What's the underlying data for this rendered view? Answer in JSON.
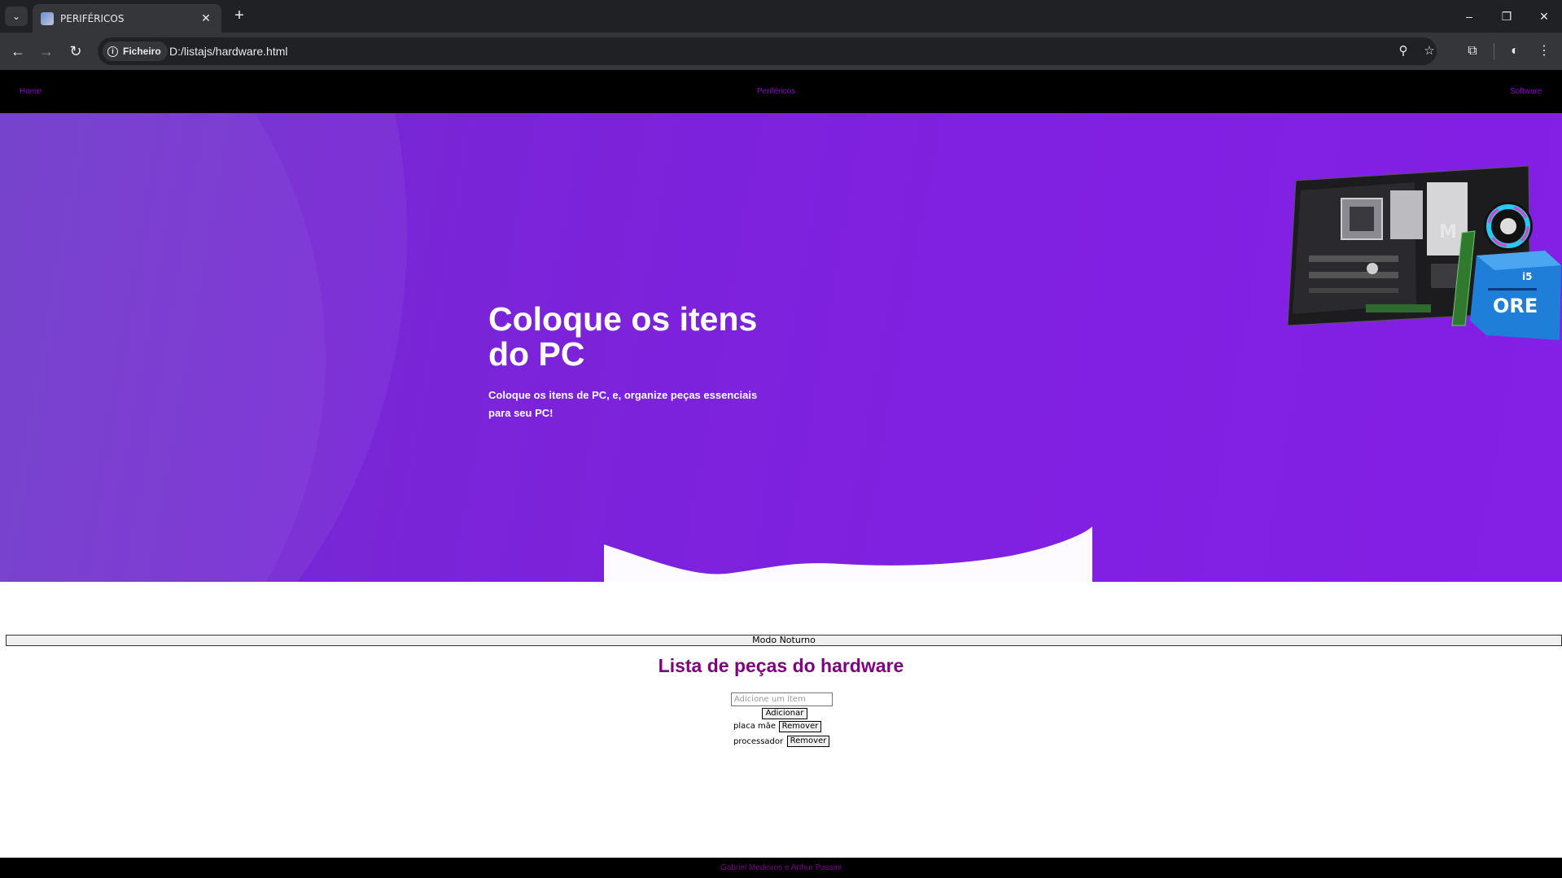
{
  "browser": {
    "tab_title": "PERIFÉRICOS",
    "site_chip_label": "Ficheiro",
    "url": "D:/listajs/hardware.html"
  },
  "nav": {
    "home": "Home",
    "perifericos": "Periféricos",
    "software": "Software"
  },
  "hero": {
    "title": "Coloque os itens do PC",
    "subtitle": "Coloque os itens de PC, e, organize peças essenciais para seu PC!"
  },
  "night_mode_button": "Modo Noturno",
  "list": {
    "title": "Lista de peças do hardware",
    "input_placeholder": "Adicione um item",
    "add_button": "Adicionar",
    "items": [
      {
        "label": "placa mãe",
        "remove": "Remover"
      },
      {
        "label": "processador",
        "remove": "Remover"
      }
    ]
  },
  "footer": {
    "credits": "Gabriel Medeiros e Arthur Passini"
  },
  "colors": {
    "hero_gradient": "#7a24d8",
    "nav_link": "#8b00c9",
    "list_title": "#800080"
  }
}
